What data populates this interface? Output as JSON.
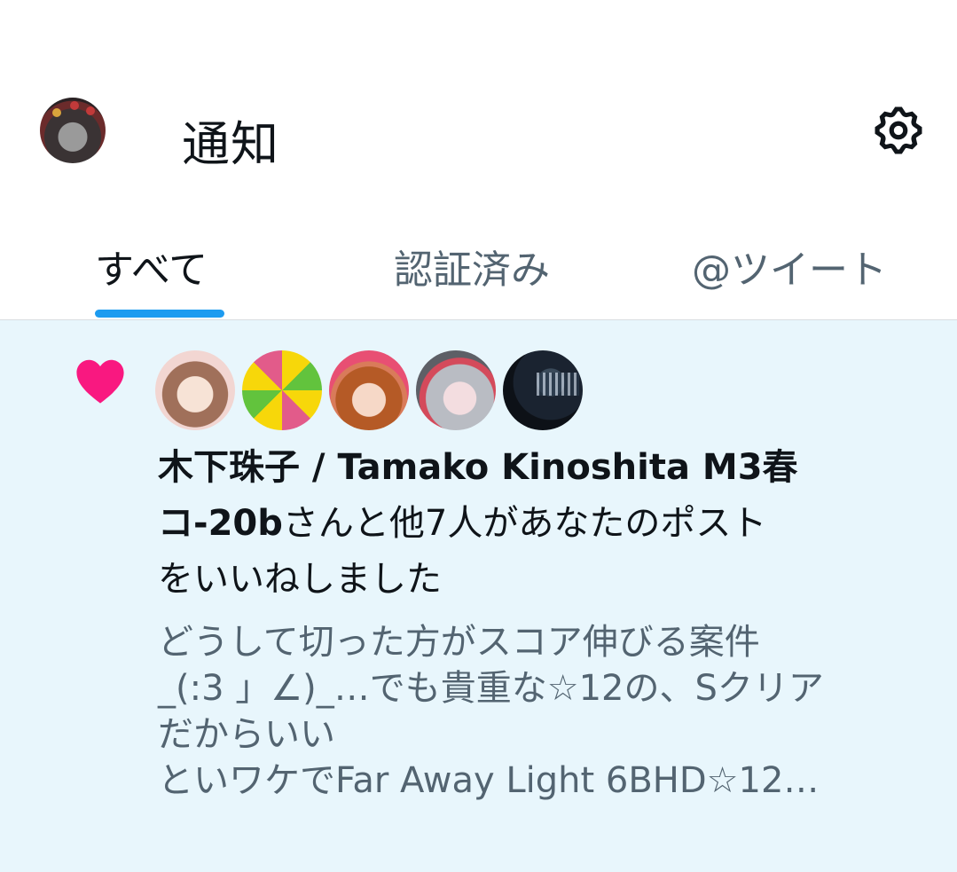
{
  "header": {
    "title": "通知",
    "avatar_icon": "profile-avatar",
    "settings_icon": "gear-icon"
  },
  "tabs": [
    {
      "label": "すべて",
      "active": true
    },
    {
      "label": "認証済み",
      "active": false
    },
    {
      "label": "@ツイート",
      "active": false
    }
  ],
  "colors": {
    "accent": "#1d9bf0",
    "like": "#f91880",
    "highlight_bg": "#e8f6fc",
    "secondary_text": "#536471"
  },
  "notification": {
    "icon": "heart-icon",
    "avatar_count": 5,
    "actor_line1": "木下珠子 / Tamako Kinoshita M3春",
    "actor_line2_bold": "コ-20b",
    "actor_line2_rest": "さんと他7人があなたのポスト",
    "action_line3": "をいいねしました",
    "preview": [
      "どうして切った方がスコア伸びる案件",
      "_(:3 」∠)_…でも貴重な☆12の、Sクリア",
      "だからいい",
      "といワケでFar Away Light 6BHD☆12…"
    ]
  }
}
